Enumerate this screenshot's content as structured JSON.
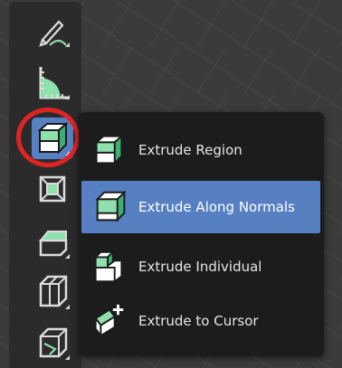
{
  "tools": [
    {
      "id": "annotate",
      "icon": "annotate-pencil-icon",
      "active": false
    },
    {
      "id": "measure",
      "icon": "measure-ruler-icon",
      "active": false
    },
    {
      "id": "extrude",
      "icon": "extrude-region-icon",
      "active": true
    },
    {
      "id": "inset",
      "icon": "inset-faces-icon",
      "active": false
    },
    {
      "id": "bevel",
      "icon": "bevel-icon",
      "active": false
    },
    {
      "id": "loop-cut",
      "icon": "loop-cut-icon",
      "active": false
    },
    {
      "id": "knife",
      "icon": "knife-icon",
      "active": false
    }
  ],
  "extrude_menu": {
    "items": [
      {
        "label": "Extrude Region",
        "icon": "extrude-region-icon",
        "highlighted": false
      },
      {
        "label": "Extrude Along Normals",
        "icon": "extrude-along-normals-icon",
        "highlighted": true
      },
      {
        "label": "Extrude Individual",
        "icon": "extrude-individual-icon",
        "highlighted": false
      },
      {
        "label": "Extrude to Cursor",
        "icon": "extrude-to-cursor-icon",
        "highlighted": false
      }
    ]
  },
  "colors": {
    "toolbar_bg": "#2b2b2b",
    "menu_bg": "#1c1c1c",
    "accent": "#5680c2",
    "icon_green": "#8ee0ac",
    "highlight_ring": "#e02424"
  }
}
